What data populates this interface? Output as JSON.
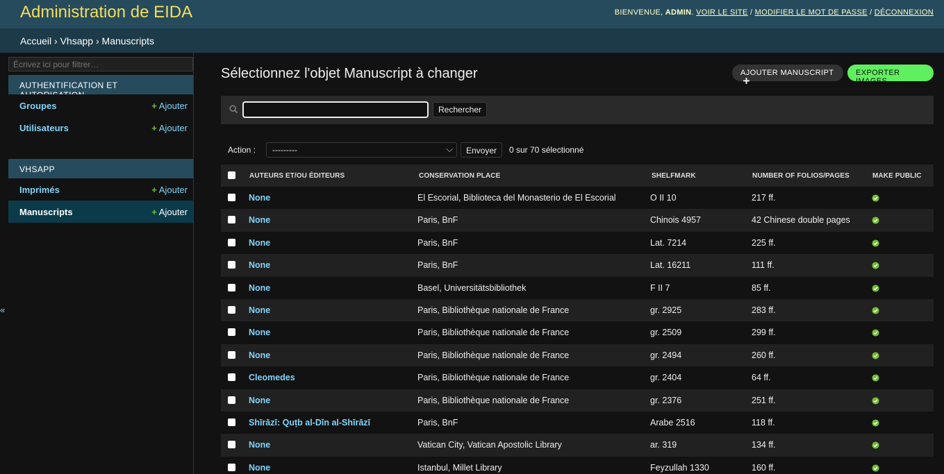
{
  "header": {
    "branding": "Administration de EIDA",
    "welcome": "Bienvenue,",
    "user": "admin",
    "links": [
      "Voir le site",
      "Modifier le mot de passe",
      "Déconnexion"
    ]
  },
  "breadcrumbs": {
    "home": "Accueil",
    "sep": "›",
    "app": "Vhsapp",
    "current": "Manuscripts"
  },
  "sidebar": {
    "filter_placeholder": "Écrivez ici pour filtrer…",
    "modules": [
      {
        "caption": "AUTHENTIFICATION ET AUTORISATION",
        "items": [
          {
            "name": "Groupes",
            "add": "Ajouter"
          },
          {
            "name": "Utilisateurs",
            "add": "Ajouter"
          }
        ]
      },
      {
        "caption": "VHSAPP",
        "items": [
          {
            "name": "Imprimés",
            "add": "Ajouter"
          },
          {
            "name": "Manuscripts",
            "add": "Ajouter"
          }
        ]
      }
    ],
    "toggle": "«"
  },
  "content": {
    "title": "Sélectionnez l'objet Manuscript à changer",
    "add_button": "Ajouter Manuscript",
    "add_icon": "plus-icon",
    "export_button": "Exporter images",
    "search_button": "Rechercher",
    "action_label": "Action :",
    "action_value": "---------",
    "go_button": "Envoyer",
    "selection_count": "0 sur 70 sélectionné"
  },
  "table": {
    "headers": [
      "Auteurs et/ou éditeurs",
      "Conservation place",
      "Shelfmark",
      "Number of folios/pages",
      "Make public"
    ],
    "rows": [
      {
        "author": "None",
        "place": "El Escorial, Biblioteca del Monasterio de El Escorial",
        "shelfmark": "O II 10",
        "folios": "217 ff.",
        "public": true
      },
      {
        "author": "None",
        "place": "Paris, BnF",
        "shelfmark": "Chinois 4957",
        "folios": "42 Chinese double pages",
        "public": true
      },
      {
        "author": "None",
        "place": "Paris, BnF",
        "shelfmark": "Lat. 7214",
        "folios": "225 ff.",
        "public": true
      },
      {
        "author": "None",
        "place": "Paris, BnF",
        "shelfmark": "Lat. 16211",
        "folios": "111 ff.",
        "public": true
      },
      {
        "author": "None",
        "place": "Basel, Universitätsbibliothek",
        "shelfmark": "F II 7",
        "folios": "85 ff.",
        "public": true
      },
      {
        "author": "None",
        "place": "Paris, Bibliothèque nationale de France",
        "shelfmark": "gr. 2925",
        "folios": "283 ff.",
        "public": true
      },
      {
        "author": "None",
        "place": "Paris, Bibliothèque nationale de France",
        "shelfmark": "gr. 2509",
        "folios": "299 ff.",
        "public": true
      },
      {
        "author": "None",
        "place": "Paris, Bibliothèque nationale de France",
        "shelfmark": "gr. 2494",
        "folios": "260 ff.",
        "public": true
      },
      {
        "author": "Cleomedes",
        "place": "Paris, Bibliothèque nationale de France",
        "shelfmark": "gr. 2404",
        "folios": "64 ff.",
        "public": true
      },
      {
        "author": "None",
        "place": "Paris, Bibliothèque nationale de France",
        "shelfmark": "gr. 2376",
        "folios": "251 ff.",
        "public": true
      },
      {
        "author": "Shīrāzī: Quṭb al-Dīn al-Shīrāzī",
        "place": "Paris, BnF",
        "shelfmark": "Arabe 2516",
        "folios": "118 ff.",
        "public": true
      },
      {
        "author": "None",
        "place": "Vatican City, Vatican Apostolic Library",
        "shelfmark": "ar. 319",
        "folios": "134 ff.",
        "public": true
      },
      {
        "author": "None",
        "place": "Istanbul, Millet Library",
        "shelfmark": "Feyzullah 1330",
        "folios": "160 ff.",
        "public": true
      }
    ]
  },
  "colors": {
    "header_bg": "#264b5d",
    "branding": "#f5dd5d",
    "link": "#81d4fa",
    "add_green": "#70bf2b",
    "export_bg": "#5ff05f",
    "public_icon": "#70bf2b"
  }
}
